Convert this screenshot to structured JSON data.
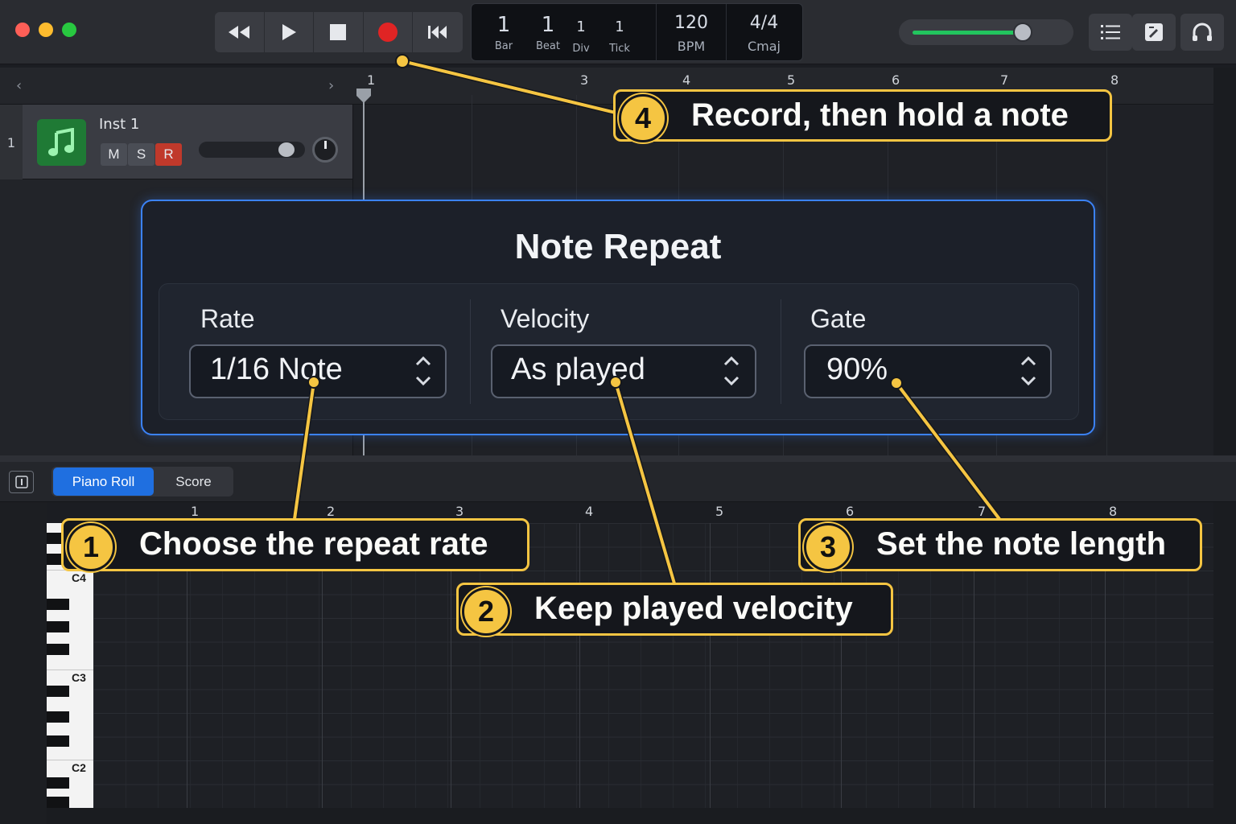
{
  "transport": {
    "lcd": {
      "bar": "1",
      "beat": "1",
      "div": "1",
      "tick": "1",
      "bar_label": "Bar",
      "beat_label": "Beat",
      "div_label": "Div",
      "tick_label": "Tick",
      "bpm": "120",
      "bpm_label": "BPM",
      "signature": "4/4",
      "key": "Cmaj"
    }
  },
  "tracks": {
    "items": [
      {
        "number": "1",
        "name": "Inst 1",
        "mute": "M",
        "solo": "S",
        "record": "R"
      }
    ]
  },
  "ruler": {
    "bars": [
      "1",
      "3",
      "4",
      "5",
      "6",
      "7",
      "8"
    ]
  },
  "note_repeat": {
    "title": "Note Repeat",
    "rate": {
      "label": "Rate",
      "value": "1/16 Note"
    },
    "velocity": {
      "label": "Velocity",
      "value": "As played"
    },
    "gate": {
      "label": "Gate",
      "value": "90%"
    }
  },
  "editor": {
    "tabs": [
      {
        "label": "Piano Roll",
        "active": true
      },
      {
        "label": "Score",
        "active": false
      }
    ],
    "ruler": [
      "1",
      "2",
      "3",
      "4",
      "5",
      "6",
      "7",
      "8"
    ],
    "keys": [
      "C4",
      "C3",
      "C2"
    ]
  },
  "callouts": [
    {
      "number": "1",
      "text": "Choose the repeat rate"
    },
    {
      "number": "2",
      "text": "Keep played velocity"
    },
    {
      "number": "3",
      "text": "Set the note length"
    },
    {
      "number": "4",
      "text": "Record, then hold a note"
    }
  ],
  "colors": {
    "accent": "#3b82f6",
    "callout": "#f5c542",
    "record": "#e02424",
    "track_icon": "#1f7a35"
  }
}
